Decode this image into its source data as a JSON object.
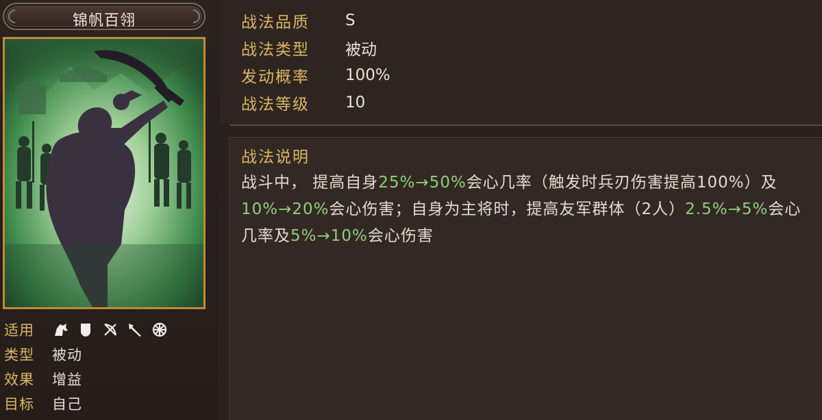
{
  "skill": {
    "name": "锦帆百翎"
  },
  "attributes": {
    "applicable": {
      "label": "适用",
      "icons": [
        "cavalry-icon",
        "shield-icon",
        "bow-icon",
        "spear-icon",
        "wheel-icon"
      ]
    },
    "type": {
      "label": "类型",
      "value": "被动"
    },
    "effect": {
      "label": "效果",
      "value": "增益"
    },
    "target": {
      "label": "目标",
      "value": "自己"
    }
  },
  "stats": [
    {
      "label": "战法品质",
      "value": "S"
    },
    {
      "label": "战法类型",
      "value": "被动"
    },
    {
      "label": "发动概率",
      "value": "100%"
    },
    {
      "label": "战法等级",
      "value": "10"
    }
  ],
  "description": {
    "title": "战法说明",
    "segments": [
      {
        "text": "战斗中，  提高自身",
        "hl": false
      },
      {
        "text": "25%→50%",
        "hl": true
      },
      {
        "text": "会心几率（触发时兵刃伤害提高100%）及",
        "hl": false
      },
      {
        "text": "10%→20%",
        "hl": true
      },
      {
        "text": "会心伤害；自身为主将时，提高友军群体（2人）",
        "hl": false
      },
      {
        "text": "2.5%→5%",
        "hl": true
      },
      {
        "text": "会心几率及",
        "hl": false
      },
      {
        "text": "5%→10%",
        "hl": true
      },
      {
        "text": "会心伤害",
        "hl": false
      }
    ]
  },
  "colors": {
    "gold_label": "#d9b864",
    "highlight_green": "#8fd07a",
    "frame_gold": "#c08a3a"
  }
}
